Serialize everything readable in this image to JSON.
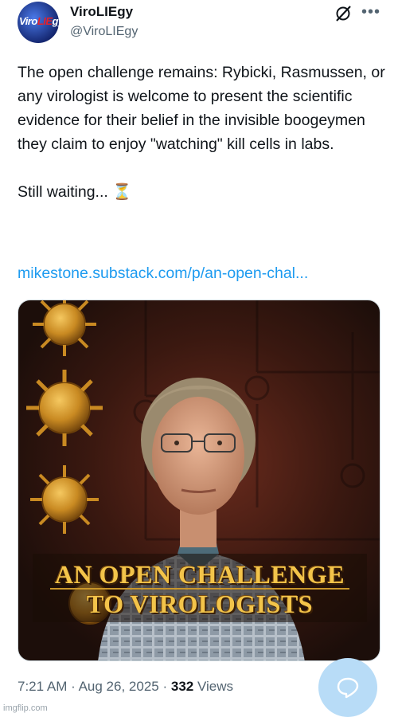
{
  "author": {
    "display_name": "ViroLIEgy",
    "handle": "@ViroLIEgy",
    "avatar_text_left": "Viro",
    "avatar_text_red": "LIE",
    "avatar_text_right": "gy"
  },
  "tweet": {
    "text_paragraph_1": "The open challenge remains: Rybicki, Rasmussen, or any virologist is welcome to present the scientific evidence for their belief in the invisible boogeymen they claim to enjoy \"watching\" kill cells in labs.",
    "text_paragraph_2": "Still waiting... ⏳",
    "link": "mikestone.substack.com/p/an-open-chal..."
  },
  "media": {
    "banner_line_1": "AN OPEN CHALLENGE",
    "banner_line_2": "TO VIROLOGISTS"
  },
  "meta": {
    "time": "7:21 AM",
    "date": "Aug 26, 2025",
    "views_count": "332",
    "views_label": "Views",
    "separator": "·"
  },
  "watermark": "imgflip.com",
  "icons": {
    "grok": "grok-icon",
    "more": "more-icon",
    "reply": "reply-icon"
  },
  "colors": {
    "link": "#1d9bf0",
    "secondary_text": "#536471",
    "primary_text": "#0f1419",
    "banner_gold": "#f3c44a"
  }
}
